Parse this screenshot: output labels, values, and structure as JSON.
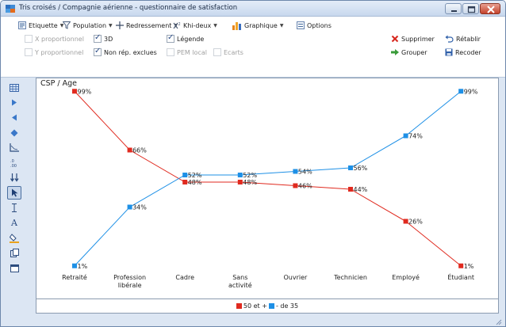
{
  "window": {
    "title": "Tris croisés / Compagnie aérienne - questionnaire de satisfaction"
  },
  "toolbar": {
    "menu": [
      {
        "label": "Etiquette",
        "icon": "label-icon"
      },
      {
        "label": "Population",
        "icon": "funnel-icon"
      },
      {
        "label": "Redressement",
        "icon": "crosshair-icon"
      },
      {
        "label": "Khi-deux",
        "icon": "chi-square-icon"
      },
      {
        "label": "Graphique",
        "icon": "bar-chart-icon"
      },
      {
        "label": "Options",
        "icon": "options-icon"
      }
    ],
    "delete_label": "Supprimer",
    "restore_label": "Rétablir",
    "group_label": "Grouper",
    "recode_label": "Recoder",
    "options": [
      {
        "label": "X proportionnel",
        "checked": false,
        "enabled": false
      },
      {
        "label": "3D",
        "checked": true,
        "enabled": true
      },
      {
        "label": "Légende",
        "checked": true,
        "enabled": true
      },
      {
        "label": "Y proportionnel",
        "checked": false,
        "enabled": false
      },
      {
        "label": "Non rép. exclues",
        "checked": true,
        "enabled": true
      },
      {
        "label": "PEM local",
        "checked": false,
        "enabled": false
      },
      {
        "label": "Ecarts",
        "checked": false,
        "enabled": false
      }
    ]
  },
  "side_tools": [
    "table-icon",
    "arrow-right-icon",
    "arrow-left-icon",
    "diamond-icon",
    "axis-icon",
    "decimals-icon",
    "sort-icon",
    "pointer-icon",
    "text-cursor-icon",
    "font-icon",
    "fill-color-icon",
    "copy-icon",
    "window-icon"
  ],
  "chart_data": {
    "type": "line",
    "title": "CSP / Age",
    "categories": [
      "Retraité",
      "Profession libérale",
      "Cadre",
      "Sans activité",
      "Ouvrier",
      "Technicien",
      "Employé",
      "Étudiant"
    ],
    "series": [
      {
        "name": "50 et +",
        "color": "#e02a1f",
        "values": [
          99,
          66,
          48,
          48,
          46,
          44,
          26,
          1
        ]
      },
      {
        "name": "- de 35",
        "color": "#1e90e6",
        "values": [
          1,
          34,
          52,
          52,
          54,
          56,
          74,
          99
        ]
      }
    ],
    "value_suffix": "%",
    "ylim": [
      0,
      100
    ],
    "legend_position": "bottom",
    "grid": false
  },
  "colors": {
    "series_50_plus": "#e02a1f",
    "series_under_35": "#1e90e6",
    "window_chrome": "#dce6f3"
  }
}
